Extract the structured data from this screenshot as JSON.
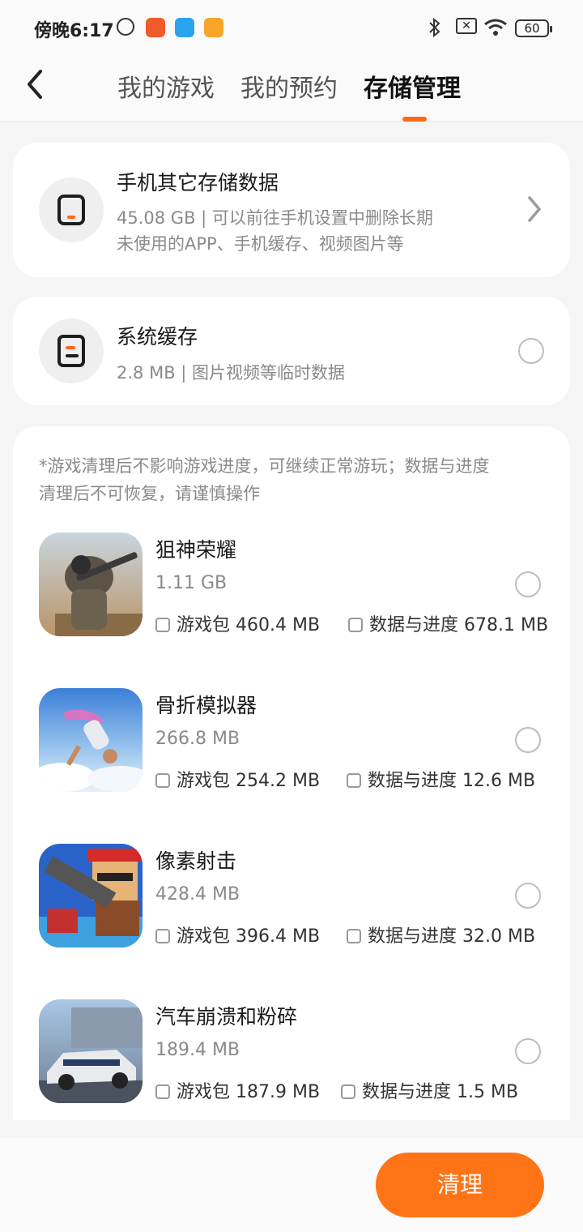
{
  "status_bar": {
    "time": "傍晚6:17",
    "battery": "60",
    "icons": [
      "alarm-icon",
      "video-app-icon",
      "browser-app-icon",
      "notes-app-icon",
      "bluetooth-icon",
      "sim-icon",
      "wifi-icon",
      "battery-icon"
    ]
  },
  "header": {
    "back_icon": "chevron-left-icon",
    "tabs": [
      {
        "label": "我的游戏",
        "active": false
      },
      {
        "label": "我的预约",
        "active": false
      },
      {
        "label": "存储管理",
        "active": true
      }
    ],
    "accent": "#ff6a1a"
  },
  "other_storage": {
    "title": "手机其它存储数据",
    "subtitle_line1": "45.08 GB | 可以前往手机设置中删除长期",
    "subtitle_line2": "未使用的APP、手机缓存、视频图片等",
    "icon": "phone-icon"
  },
  "system_cache": {
    "title": "系统缓存",
    "subtitle": "2.8 MB | 图片视频等临时数据",
    "icon": "document-icon"
  },
  "games_section": {
    "notice_line1": "*游戏清理后不影响游戏进度，可继续正常游玩；数据与进度",
    "notice_line2": "清理后不可恢复，请谨慎操作",
    "games": [
      {
        "name": "狙神荣耀",
        "size": "1.11 GB",
        "package": "游戏包 460.4 MB",
        "data": "数据与进度 678.1 MB"
      },
      {
        "name": "骨折模拟器",
        "size": "266.8 MB",
        "package": "游戏包 254.2 MB",
        "data": "数据与进度 12.6 MB"
      },
      {
        "name": "像素射击",
        "size": "428.4 MB",
        "package": "游戏包 396.4 MB",
        "data": "数据与进度 32.0 MB"
      },
      {
        "name": "汽车崩溃和粉碎",
        "size": "189.4 MB",
        "package": "游戏包 187.9 MB",
        "data": "数据与进度 1.5 MB"
      }
    ]
  },
  "action": {
    "clean_label": "清理",
    "color": "#ff7417"
  }
}
